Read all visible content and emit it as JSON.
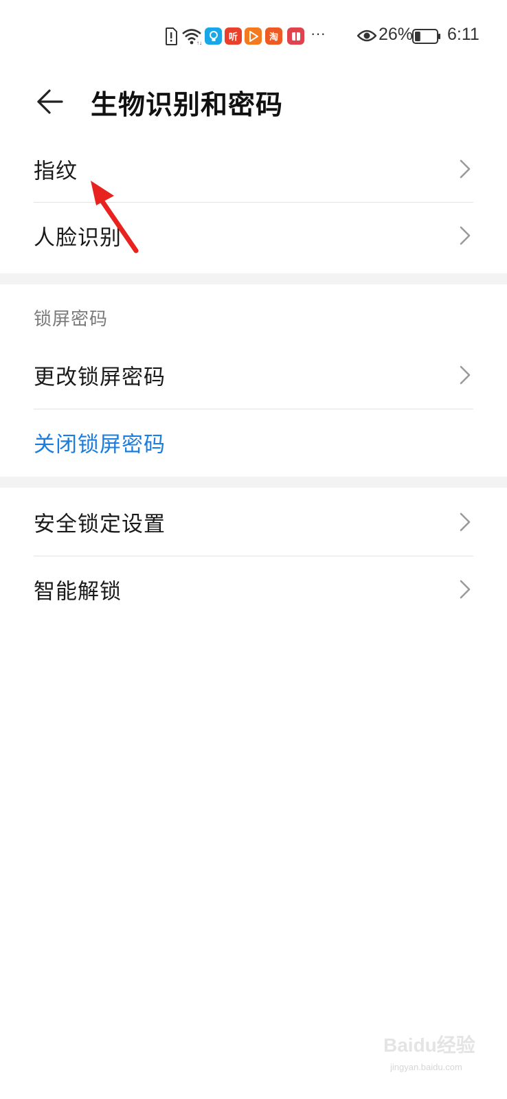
{
  "status_bar": {
    "app_icons": [
      {
        "name": "idea-app-icon",
        "glyph": "💡",
        "color": "#1aa7e8"
      },
      {
        "name": "ting-app-icon",
        "glyph": "听",
        "color": "#e8402a"
      },
      {
        "name": "video-app-icon",
        "glyph": "▶",
        "color": "#f47a1f"
      },
      {
        "name": "shopping-app-icon",
        "glyph": "淘",
        "color": "#ee5a24"
      },
      {
        "name": "reader-app-icon",
        "glyph": "▮",
        "color": "#e0434d"
      }
    ],
    "more": "···",
    "battery_percent": "26%",
    "battery_level": 0.26,
    "time": "6:11"
  },
  "header": {
    "title": "生物识别和密码"
  },
  "sections": {
    "biometrics": {
      "items": [
        {
          "label": "指纹"
        },
        {
          "label": "人脸识别"
        }
      ]
    },
    "lock_screen": {
      "title": "锁屏密码",
      "items": [
        {
          "label": "更改锁屏密码"
        },
        {
          "label": "关闭锁屏密码"
        }
      ]
    },
    "other": {
      "items": [
        {
          "label": "安全锁定设置"
        },
        {
          "label": "智能解锁"
        }
      ]
    }
  },
  "watermark": {
    "text": "Baidu经验",
    "sub": "jingyan.baidu.com"
  },
  "colors": {
    "accent_blue": "#1a7de0",
    "annotation_red": "#e8231f",
    "divider": "#e2e2e2",
    "section_gap": "#f3f3f3"
  }
}
